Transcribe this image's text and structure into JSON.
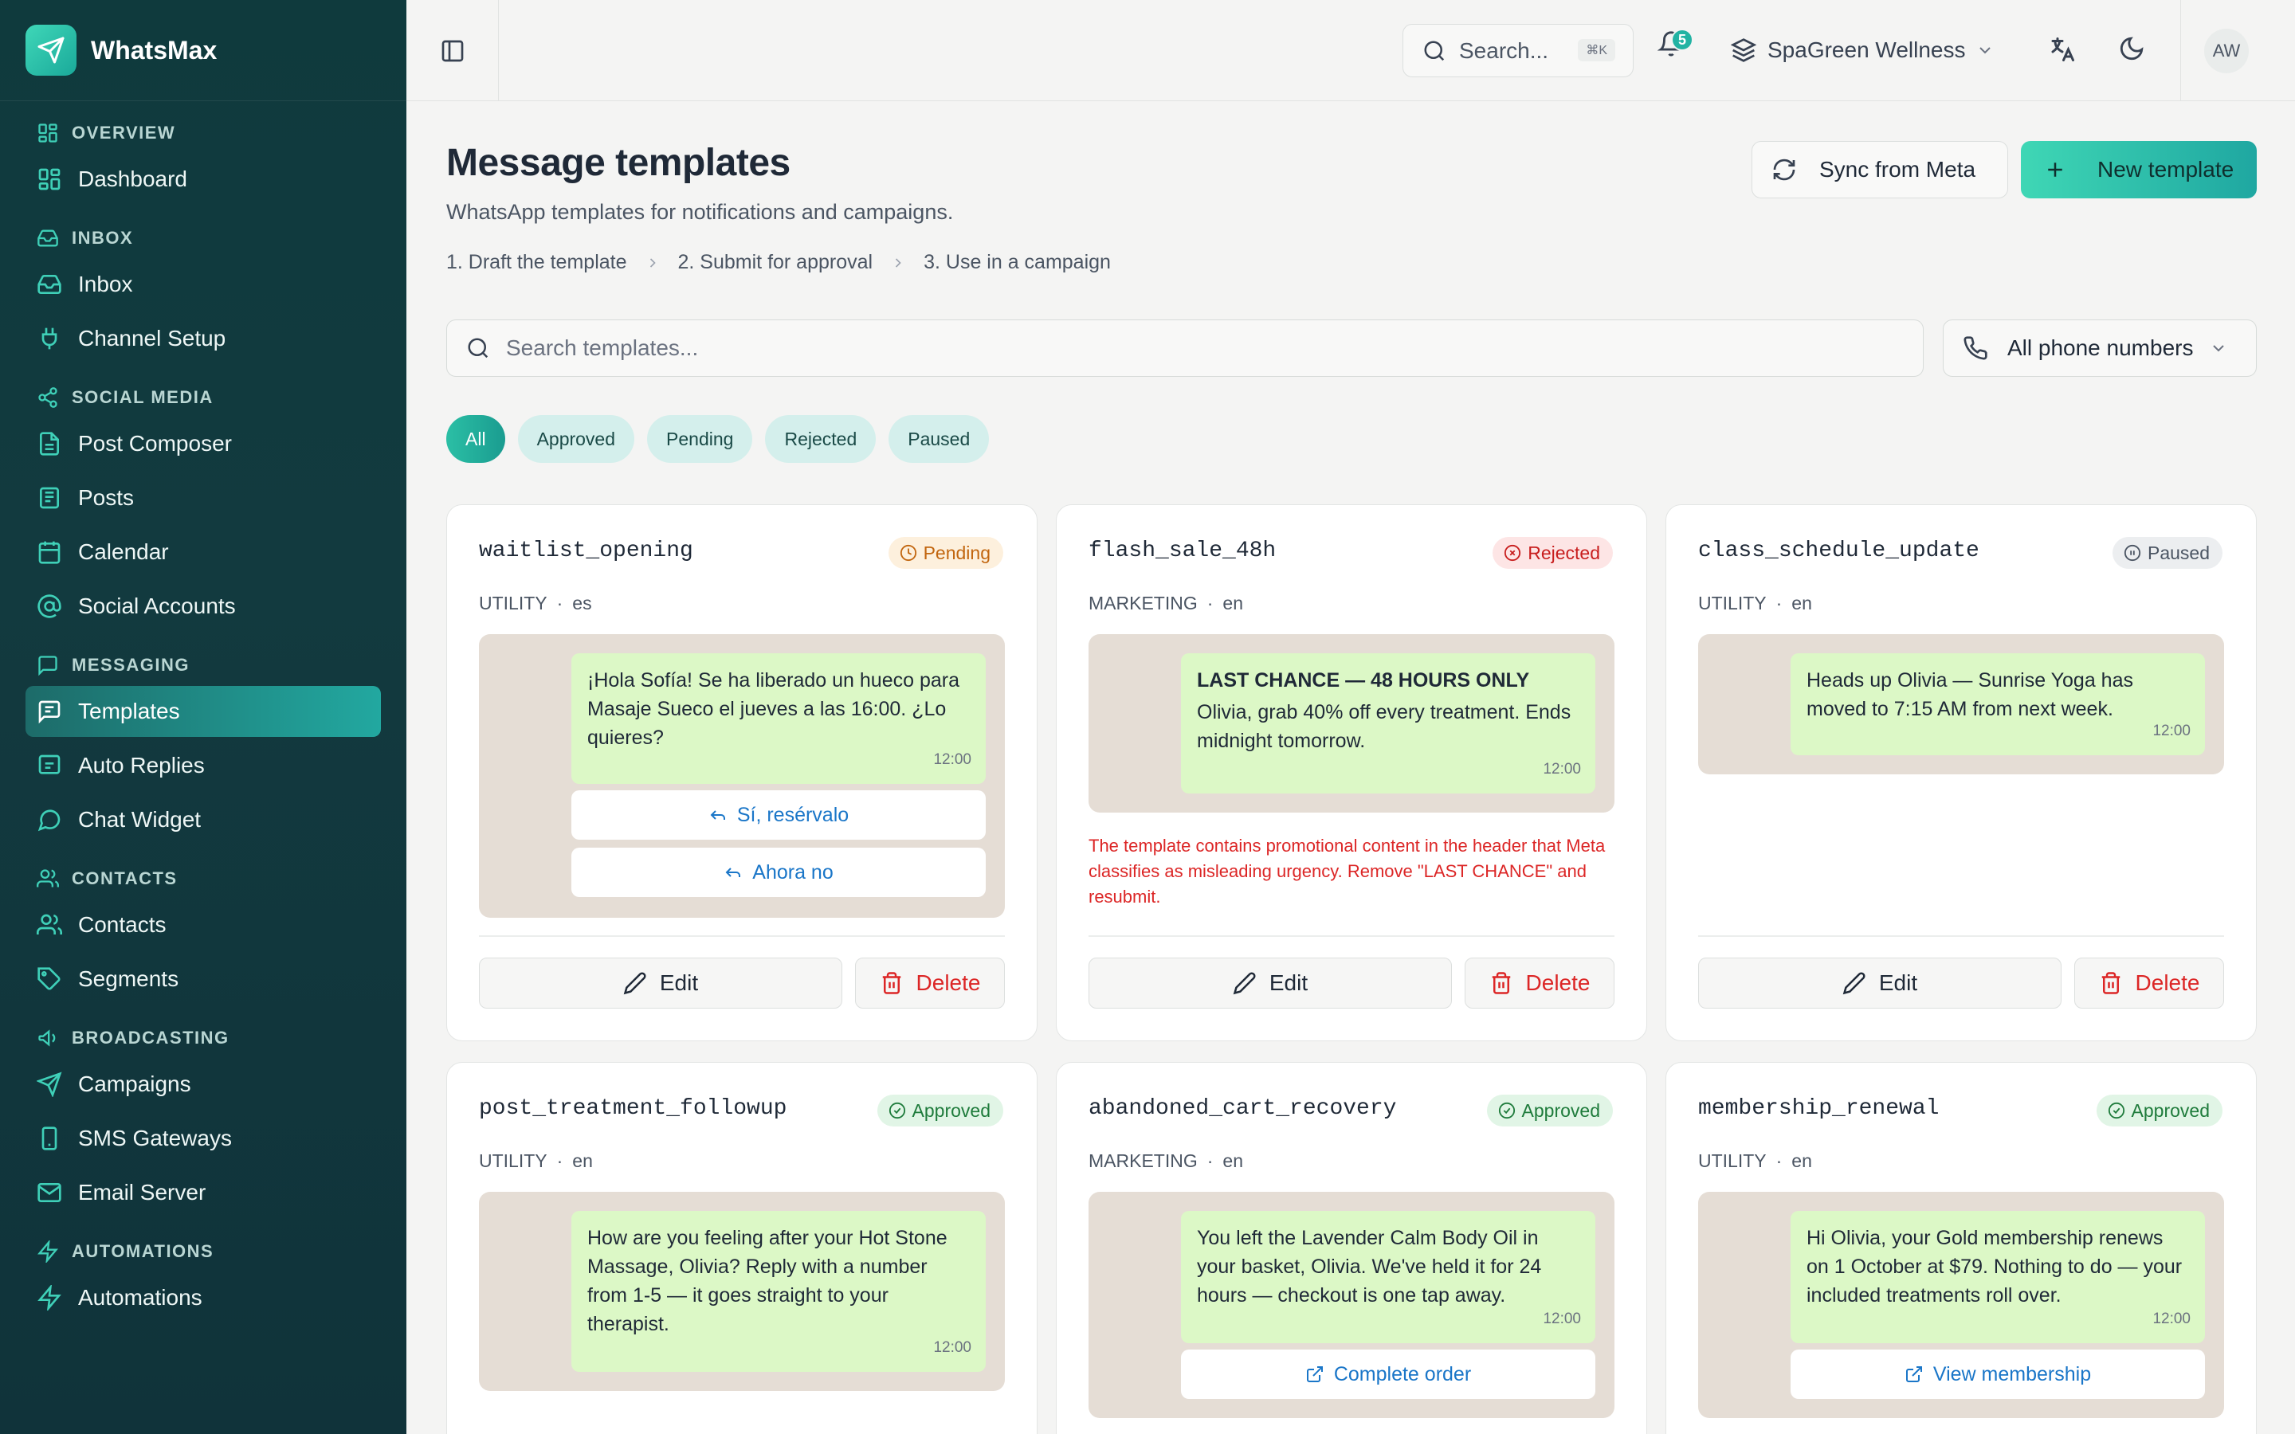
{
  "app": {
    "name": "WhatsMax"
  },
  "sidebar": {
    "sections": [
      {
        "title": "OVERVIEW",
        "items": [
          {
            "label": "Dashboard"
          }
        ]
      },
      {
        "title": "INBOX",
        "items": [
          {
            "label": "Inbox"
          },
          {
            "label": "Channel Setup"
          }
        ]
      },
      {
        "title": "SOCIAL MEDIA",
        "items": [
          {
            "label": "Post Composer"
          },
          {
            "label": "Posts"
          },
          {
            "label": "Calendar"
          },
          {
            "label": "Social Accounts"
          }
        ]
      },
      {
        "title": "MESSAGING",
        "items": [
          {
            "label": "Templates"
          },
          {
            "label": "Auto Replies"
          },
          {
            "label": "Chat Widget"
          }
        ]
      },
      {
        "title": "CONTACTS",
        "items": [
          {
            "label": "Contacts"
          },
          {
            "label": "Segments"
          }
        ]
      },
      {
        "title": "BROADCASTING",
        "items": [
          {
            "label": "Campaigns"
          },
          {
            "label": "SMS Gateways"
          },
          {
            "label": "Email Server"
          }
        ]
      },
      {
        "title": "AUTOMATIONS",
        "items": [
          {
            "label": "Automations"
          }
        ]
      }
    ],
    "active_item": "Templates"
  },
  "topbar": {
    "search_label": "Search...",
    "search_shortcut": "⌘K",
    "notification_count": "5",
    "workspace": "SpaGreen Wellness",
    "avatar_initials": "AW"
  },
  "page": {
    "title": "Message templates",
    "subtitle": "WhatsApp templates for notifications and campaigns.",
    "steps": [
      "1. Draft the template",
      "2. Submit for approval",
      "3. Use in a campaign"
    ],
    "sync_button": "Sync from Meta",
    "new_button": "New template",
    "search_placeholder": "Search templates...",
    "phone_filter": "All phone numbers",
    "filters": [
      "All",
      "Approved",
      "Pending",
      "Rejected",
      "Paused"
    ],
    "active_filter": "All"
  },
  "actions": {
    "edit": "Edit",
    "delete": "Delete"
  },
  "templates": [
    {
      "name": "waitlist_opening",
      "status": "Pending",
      "category": "UTILITY",
      "language": "es",
      "body": "¡Hola Sofía! Se ha liberado un hueco para Masaje Sueco el jueves a las 16:00. ¿Lo quieres?",
      "time": "12:00",
      "buttons": [
        "Sí, resérvalo",
        "Ahora no"
      ]
    },
    {
      "name": "flash_sale_48h",
      "status": "Rejected",
      "category": "MARKETING",
      "language": "en",
      "header": "LAST CHANCE — 48 HOURS ONLY",
      "body": "Olivia, grab 40% off every treatment. Ends midnight tomorrow.",
      "time": "12:00",
      "rejection_reason": "The template contains promotional content in the header that Meta classifies as misleading urgency. Remove \"LAST CHANCE\" and resubmit."
    },
    {
      "name": "class_schedule_update",
      "status": "Paused",
      "category": "UTILITY",
      "language": "en",
      "body": "Heads up Olivia — Sunrise Yoga has moved to 7:15 AM from next week.",
      "time": "12:00"
    },
    {
      "name": "post_treatment_followup",
      "status": "Approved",
      "category": "UTILITY",
      "language": "en",
      "body": "How are you feeling after your Hot Stone Massage, Olivia? Reply with a number from 1-5 — it goes straight to your therapist.",
      "time": "12:00"
    },
    {
      "name": "abandoned_cart_recovery",
      "status": "Approved",
      "category": "MARKETING",
      "language": "en",
      "body": "You left the Lavender Calm Body Oil in your basket, Olivia. We've held it for 24 hours — checkout is one tap away.",
      "time": "12:00",
      "cta": "Complete order"
    },
    {
      "name": "membership_renewal",
      "status": "Approved",
      "category": "UTILITY",
      "language": "en",
      "body": "Hi Olivia, your Gold membership renews on 1 October at $79. Nothing to do — your included treatments roll over.",
      "time": "12:00",
      "cta": "View membership"
    }
  ],
  "colors": {
    "sidebar_bg": "#0f3a3d",
    "accent": "#22b3a3",
    "pending": "#c2660f",
    "rejected": "#c81e1e",
    "approved": "#1e7b3b",
    "bubble": "#dcf8c6",
    "chat_bg": "#e5ddd5"
  }
}
